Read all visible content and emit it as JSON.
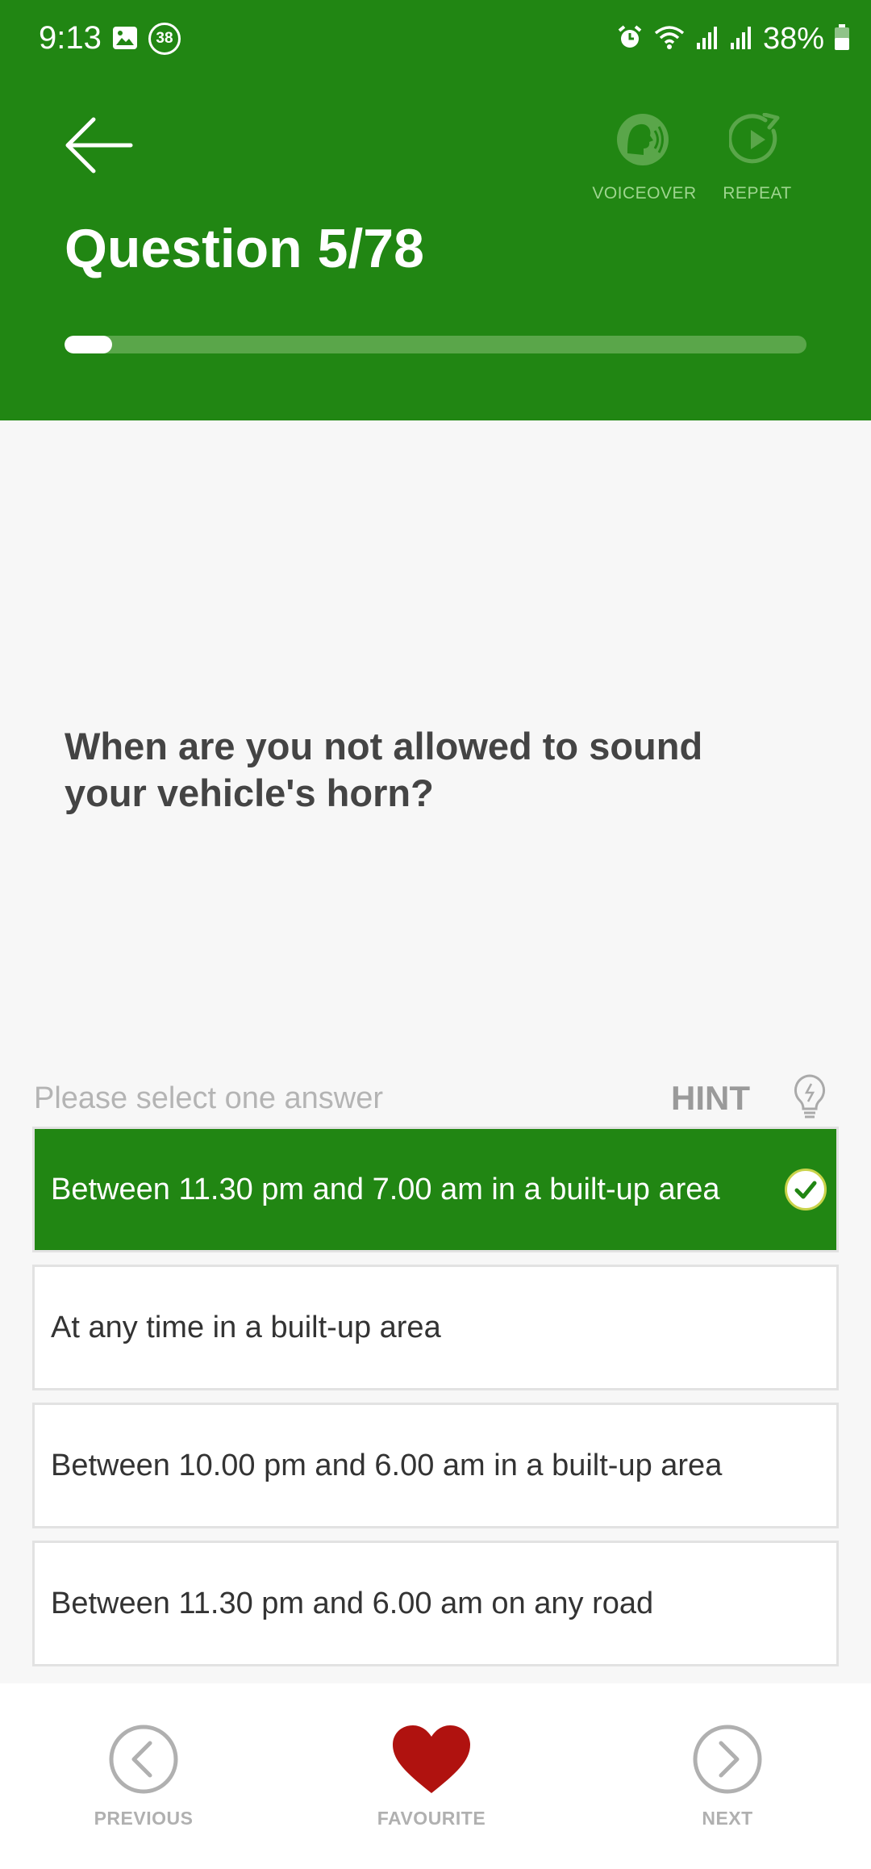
{
  "status_bar": {
    "time": "9:13",
    "notification_count": "38",
    "battery": "38%",
    "icons": [
      "gallery-icon",
      "alarm-icon",
      "wifi-icon",
      "signal-icon",
      "signal-icon",
      "battery-icon"
    ]
  },
  "header": {
    "voiceover_label": "VOICEOVER",
    "repeat_label": "REPEAT",
    "title": "Question 5/78",
    "progress_fraction": 0.064
  },
  "question": {
    "text": "When are you not allowed to sound your vehicle's horn?"
  },
  "answer_prompt": "Please select one answer",
  "hint_label": "HINT",
  "answers": [
    {
      "label": "Between 11.30 pm and 7.00 am in a built-up area",
      "selected": true
    },
    {
      "label": "At any time in a built-up area",
      "selected": false
    },
    {
      "label": "Between 10.00 pm and 6.00 am in a built-up area",
      "selected": false
    },
    {
      "label": "Between 11.30 pm and 6.00 am on any road",
      "selected": false
    }
  ],
  "bottom_nav": {
    "previous_label": "PREVIOUS",
    "favourite_label": "FAVOURITE",
    "next_label": "NEXT"
  },
  "colors": {
    "brand_green": "#218613",
    "progress_track": "#5aa64a",
    "favourite_red": "#b0120f"
  }
}
